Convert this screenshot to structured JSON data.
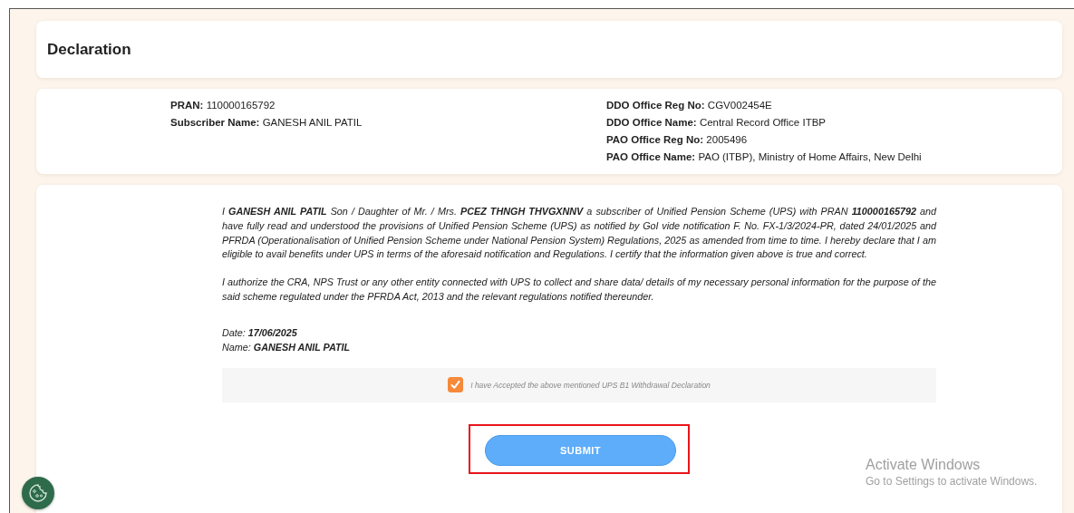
{
  "header": {
    "title": "Declaration"
  },
  "subscriber_info": {
    "left": [
      {
        "label": "PRAN:",
        "value": "110000165792"
      },
      {
        "label": "Subscriber Name:",
        "value": "GANESH ANIL PATIL"
      }
    ],
    "right": [
      {
        "label": "DDO Office Reg No:",
        "value": "CGV002454E"
      },
      {
        "label": "DDO Office Name:",
        "value": "Central Record Office ITBP"
      },
      {
        "label": "PAO Office Reg No:",
        "value": "2005496"
      },
      {
        "label": "PAO Office Name:",
        "value": "PAO (ITBP), Ministry of Home Affairs, New Delhi"
      }
    ]
  },
  "declaration": {
    "paragraphs": [
      "I **GANESH ANIL PATIL** Son / Daughter of Mr. / Mrs. **PCEZ THNGH THVGXNNV** a subscriber of Unified Pension Scheme (UPS) with PRAN **110000165792** and have fully read and understood the provisions of Unified Pension Scheme (UPS) as notified by GoI vide notification F. No. FX-1/3/2024-PR, dated 24/01/2025 and PFRDA (Operationalisation of Unified Pension Scheme under National Pension System) Regulations, 2025 as amended from time to time. I hereby declare that I am eligible to avail benefits under UPS in terms of the aforesaid notification and Regulations. I certify that the information given above is true and correct.",
      "I authorize the CRA, NPS Trust or any other entity connected with UPS to collect and share data/ details of my necessary personal information for the purpose of the said scheme regulated under the PFRDA Act, 2013 and the relevant regulations notified thereunder."
    ],
    "signature": [
      {
        "label": "Date:",
        "value": "17/06/2025"
      },
      {
        "label": "Name:",
        "value": "GANESH ANIL PATIL"
      }
    ],
    "acceptance": {
      "label": "I have Accepted the above mentioned UPS B1 Withdrawal Declaration",
      "checked": true
    },
    "submit_button": {
      "label": "SUBMIT",
      "highlighted": true
    }
  },
  "os_overlay": {
    "title": "Activate Windows",
    "subtitle": "Go to Settings to activate Windows."
  }
}
